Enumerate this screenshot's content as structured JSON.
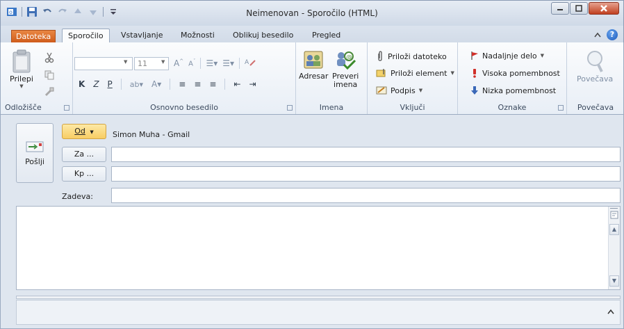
{
  "window": {
    "title": "Neimenovan - Sporočilo (HTML)",
    "controls": [
      "minimize-icon",
      "maximize-icon",
      "close-icon"
    ]
  },
  "tabs": {
    "file": "Datoteka",
    "items": [
      "Sporočilo",
      "Vstavljanje",
      "Možnosti",
      "Oblikuj besedilo",
      "Pregled"
    ],
    "active": "Sporočilo"
  },
  "ribbon": {
    "clipboard": {
      "paste": "Prilepi",
      "label": "Odložišče"
    },
    "basic_text": {
      "font_size": "11",
      "bold": "K",
      "italic": "Z",
      "underline": "P",
      "label": "Osnovno besedilo"
    },
    "names": {
      "address_book": "Adresar",
      "check_names_1": "Preveri",
      "check_names_2": "imena",
      "label": "Imena"
    },
    "include": {
      "attach_file": "Priloži datoteko",
      "attach_item": "Priloži element",
      "signature": "Podpis",
      "label": "Vključi"
    },
    "tags": {
      "follow_up": "Nadaljnje delo",
      "high_importance": "Visoka pomembnost",
      "low_importance": "Nizka pomembnost",
      "label": "Oznake"
    },
    "zoom": {
      "zoom_button": "Povečava",
      "label": "Povečava"
    }
  },
  "compose": {
    "send": "Pošlji",
    "from_button": "Od",
    "from_value": "Simon Muha - Gmail",
    "to_button": "Za ...",
    "cc_button": "Kp ...",
    "subject_label": "Zadeva:",
    "to_value": "",
    "cc_value": "",
    "subject_value": "",
    "body_text": ""
  },
  "colors": {
    "file_tab": "#cf5b1a",
    "from_button": "#f8cd63",
    "close_button": "#c1401f",
    "help_icon": "#1a58b9"
  }
}
